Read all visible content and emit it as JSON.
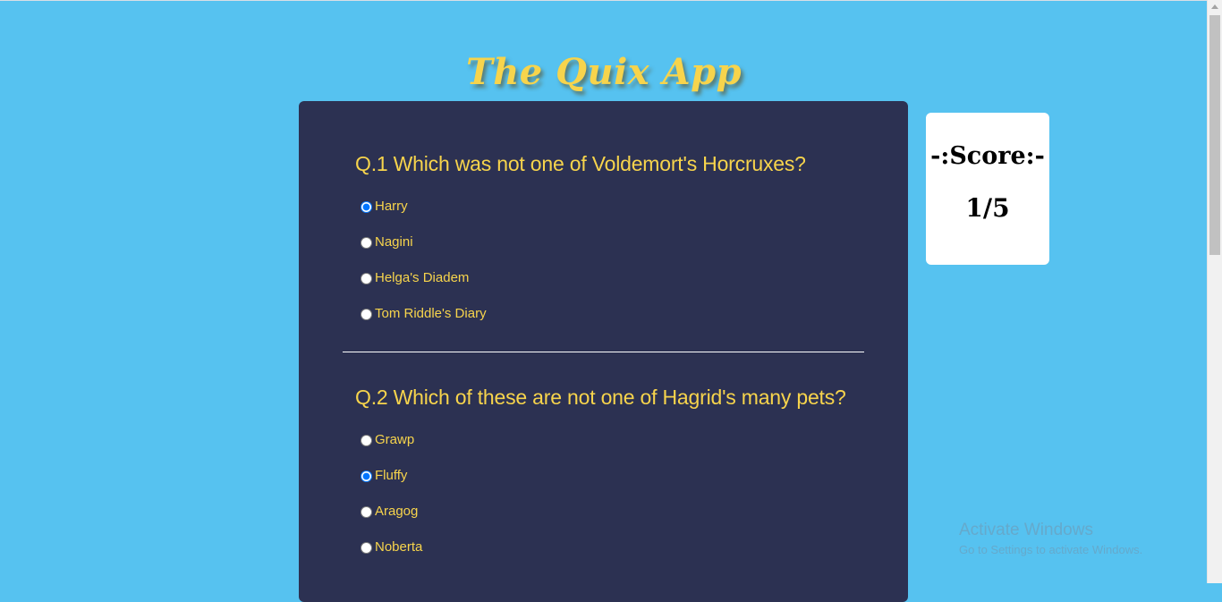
{
  "app": {
    "title": "The Quix App"
  },
  "questions": [
    {
      "text": "Q.1 Which was not one of Voldemort's Horcruxes?",
      "options": [
        "Harry",
        "Nagini",
        "Helga's Diadem",
        "Tom Riddle's Diary"
      ],
      "selected": "Harry"
    },
    {
      "text": "Q.2 Which of these are not one of Hagrid's many pets?",
      "options": [
        "Grawp",
        "Fluffy",
        "Aragog",
        "Noberta"
      ],
      "selected": "Fluffy"
    }
  ],
  "score": {
    "heading": "-:Score:-",
    "value": "1/5"
  },
  "watermark": {
    "title": "Activate Windows",
    "subtitle": "Go to Settings to activate Windows."
  },
  "colors": {
    "background": "#56c2f0",
    "card": "#2c3152",
    "accent": "#f7d44c",
    "score_card": "#ffffff"
  }
}
